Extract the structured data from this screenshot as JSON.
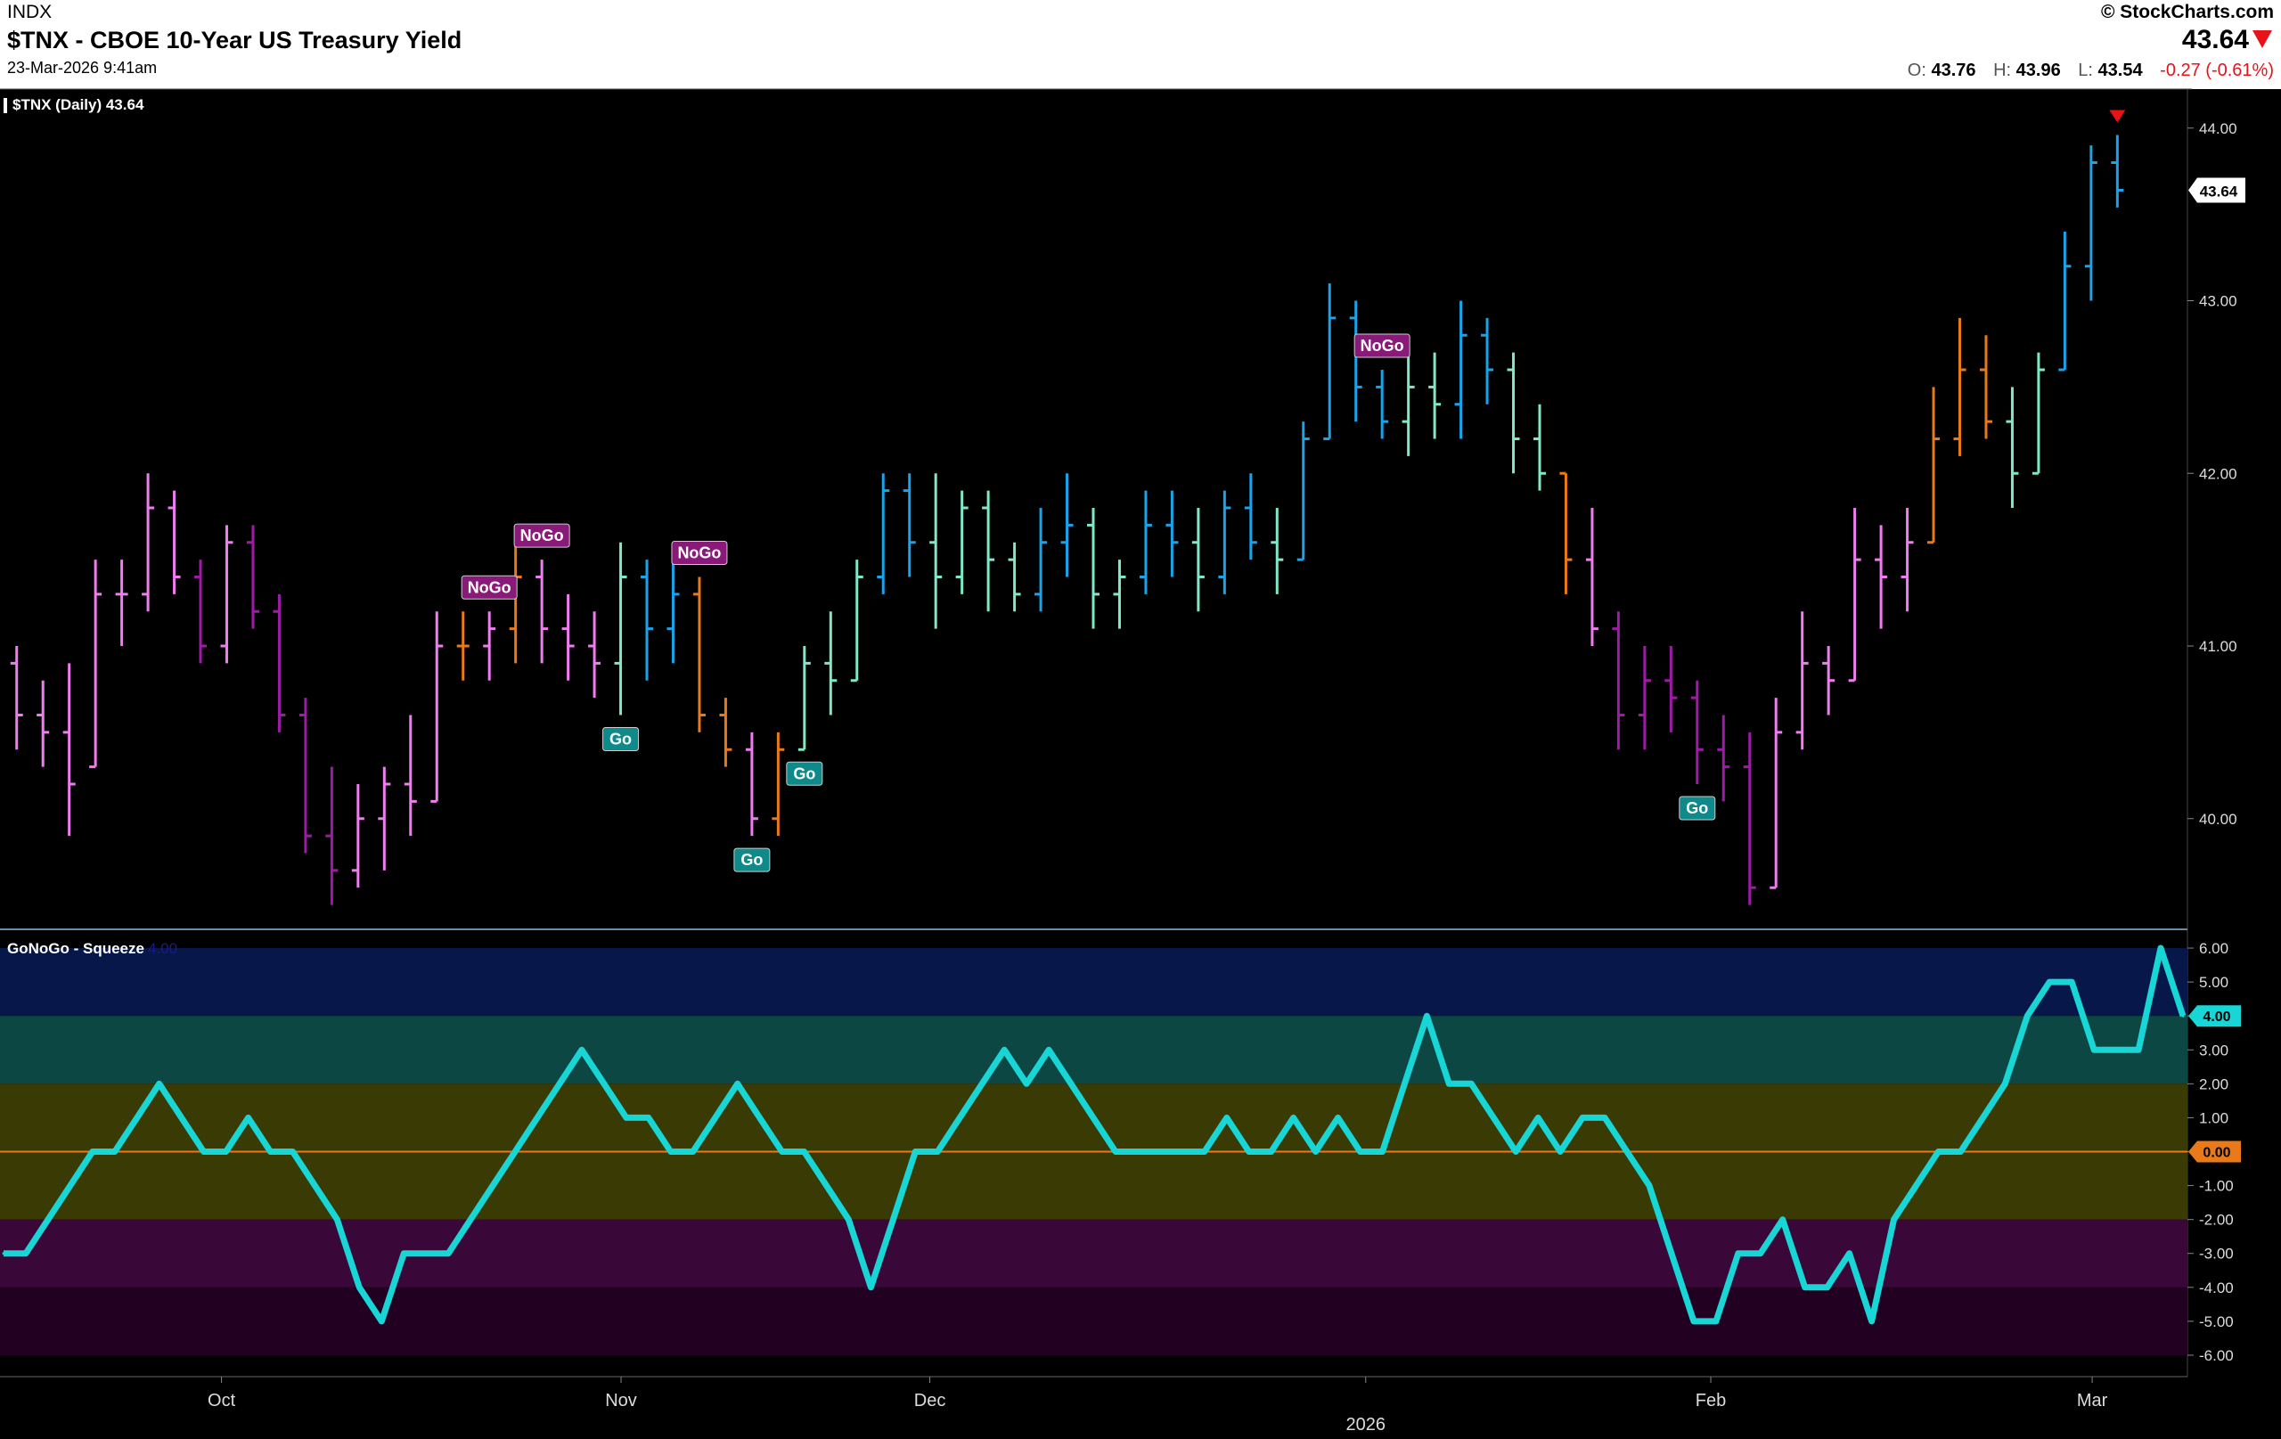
{
  "header": {
    "exchange": "INDX",
    "title": "$TNX - CBOE 10-Year US Treasury Yield",
    "date": "23-Mar-2026 9:41am",
    "brand": "© StockCharts.com",
    "last": "43.64",
    "open_label": "O:",
    "open": "43.76",
    "high_label": "H:",
    "high": "43.96",
    "low_label": "L:",
    "low": "43.54",
    "change": "-0.27 (-0.61%)"
  },
  "price_panel": {
    "label": "$TNX (Daily) 43.64",
    "last_tag": "43.64"
  },
  "sub_panel": {
    "label": "GoNoGo - Squeeze",
    "value_faint": "4.00",
    "oscillator_tag": "4.00",
    "zero_tag": "0.00"
  },
  "colors": {
    "up_strong": "#1aa3e8",
    "up_weak": "#7fe8c8",
    "down_strong": "#a01aa8",
    "down_weak": "#f07df0",
    "neutral": "#e87a1a",
    "oscillator": "#18d6d6",
    "zero_line": "#e87a1a",
    "go_badge": "#0f8a8a",
    "nogo_badge": "#8a1a7a",
    "dot": "#18e818",
    "down_signal": "#e8121a"
  },
  "chart_data": [
    {
      "type": "ohlc",
      "title": "$TNX (Daily) 43.64",
      "ylim": [
        39.4,
        44.2
      ],
      "y_ticks": [
        "44.00",
        "43.00",
        "42.00",
        "41.00",
        "40.00"
      ],
      "x_ticks": [
        "Oct",
        "Nov",
        "Dec",
        "2026",
        "Feb",
        "Mar"
      ],
      "annotations": [
        {
          "text": "NoGo",
          "index": 18
        },
        {
          "text": "NoGo",
          "index": 20
        },
        {
          "text": "Go",
          "index": 23
        },
        {
          "text": "NoGo",
          "index": 26
        },
        {
          "text": "Go",
          "index": 28
        },
        {
          "text": "Go",
          "index": 30
        },
        {
          "text": "NoGo",
          "index": 52
        },
        {
          "text": "Go",
          "index": 64
        }
      ],
      "bars": [
        {
          "o": 40.9,
          "h": 41.0,
          "l": 40.4,
          "c": 40.6,
          "k": "dw"
        },
        {
          "o": 40.6,
          "h": 40.8,
          "l": 40.3,
          "c": 40.5,
          "k": "dw"
        },
        {
          "o": 40.5,
          "h": 40.9,
          "l": 39.9,
          "c": 40.2,
          "k": "dw"
        },
        {
          "o": 40.3,
          "h": 41.5,
          "l": 40.3,
          "c": 41.3,
          "k": "dw"
        },
        {
          "o": 41.3,
          "h": 41.5,
          "l": 41.0,
          "c": 41.3,
          "k": "dw"
        },
        {
          "o": 41.3,
          "h": 42.0,
          "l": 41.2,
          "c": 41.8,
          "k": "dw"
        },
        {
          "o": 41.8,
          "h": 41.9,
          "l": 41.3,
          "c": 41.4,
          "k": "dw"
        },
        {
          "o": 41.4,
          "h": 41.5,
          "l": 40.9,
          "c": 41.0,
          "k": "ds"
        },
        {
          "o": 41.0,
          "h": 41.7,
          "l": 40.9,
          "c": 41.6,
          "k": "dw"
        },
        {
          "o": 41.6,
          "h": 41.7,
          "l": 41.1,
          "c": 41.2,
          "k": "ds"
        },
        {
          "o": 41.2,
          "h": 41.3,
          "l": 40.5,
          "c": 40.6,
          "k": "ds"
        },
        {
          "o": 40.6,
          "h": 40.7,
          "l": 39.8,
          "c": 39.9,
          "k": "ds"
        },
        {
          "o": 39.9,
          "h": 40.3,
          "l": 39.5,
          "c": 39.7,
          "k": "ds"
        },
        {
          "o": 39.7,
          "h": 40.2,
          "l": 39.6,
          "c": 40.0,
          "k": "dw"
        },
        {
          "o": 40.0,
          "h": 40.3,
          "l": 39.7,
          "c": 40.2,
          "k": "dw"
        },
        {
          "o": 40.2,
          "h": 40.6,
          "l": 39.9,
          "c": 40.1,
          "k": "dw"
        },
        {
          "o": 40.1,
          "h": 41.2,
          "l": 40.1,
          "c": 41.0,
          "k": "dw"
        },
        {
          "o": 41.0,
          "h": 41.2,
          "l": 40.8,
          "c": 41.0,
          "k": "n"
        },
        {
          "o": 41.0,
          "h": 41.2,
          "l": 40.8,
          "c": 41.1,
          "k": "dw"
        },
        {
          "o": 41.1,
          "h": 41.6,
          "l": 40.9,
          "c": 41.4,
          "k": "n"
        },
        {
          "o": 41.4,
          "h": 41.5,
          "l": 40.9,
          "c": 41.1,
          "k": "dw"
        },
        {
          "o": 41.1,
          "h": 41.3,
          "l": 40.8,
          "c": 41.0,
          "k": "dw"
        },
        {
          "o": 41.0,
          "h": 41.2,
          "l": 40.7,
          "c": 40.9,
          "k": "dw"
        },
        {
          "o": 40.9,
          "h": 41.6,
          "l": 40.6,
          "c": 41.4,
          "k": "uw"
        },
        {
          "o": 41.4,
          "h": 41.5,
          "l": 40.8,
          "c": 41.1,
          "k": "us"
        },
        {
          "o": 41.1,
          "h": 41.6,
          "l": 40.9,
          "c": 41.3,
          "k": "us"
        },
        {
          "o": 41.3,
          "h": 41.4,
          "l": 40.5,
          "c": 40.6,
          "k": "n"
        },
        {
          "o": 40.6,
          "h": 40.7,
          "l": 40.3,
          "c": 40.4,
          "k": "n"
        },
        {
          "o": 40.4,
          "h": 40.5,
          "l": 39.9,
          "c": 40.0,
          "k": "dw"
        },
        {
          "o": 40.0,
          "h": 40.5,
          "l": 39.9,
          "c": 40.4,
          "k": "n"
        },
        {
          "o": 40.4,
          "h": 41.0,
          "l": 40.4,
          "c": 40.9,
          "k": "uw"
        },
        {
          "o": 40.9,
          "h": 41.2,
          "l": 40.6,
          "c": 40.8,
          "k": "uw"
        },
        {
          "o": 40.8,
          "h": 41.5,
          "l": 40.8,
          "c": 41.4,
          "k": "uw"
        },
        {
          "o": 41.4,
          "h": 42.0,
          "l": 41.3,
          "c": 41.9,
          "k": "us"
        },
        {
          "o": 41.9,
          "h": 42.0,
          "l": 41.4,
          "c": 41.6,
          "k": "us"
        },
        {
          "o": 41.6,
          "h": 42.0,
          "l": 41.1,
          "c": 41.4,
          "k": "uw"
        },
        {
          "o": 41.4,
          "h": 41.9,
          "l": 41.3,
          "c": 41.8,
          "k": "uw"
        },
        {
          "o": 41.8,
          "h": 41.9,
          "l": 41.2,
          "c": 41.5,
          "k": "uw"
        },
        {
          "o": 41.5,
          "h": 41.6,
          "l": 41.2,
          "c": 41.3,
          "k": "uw"
        },
        {
          "o": 41.3,
          "h": 41.8,
          "l": 41.2,
          "c": 41.6,
          "k": "us"
        },
        {
          "o": 41.6,
          "h": 42.0,
          "l": 41.4,
          "c": 41.7,
          "k": "us"
        },
        {
          "o": 41.7,
          "h": 41.8,
          "l": 41.1,
          "c": 41.3,
          "k": "uw"
        },
        {
          "o": 41.3,
          "h": 41.5,
          "l": 41.1,
          "c": 41.4,
          "k": "uw"
        },
        {
          "o": 41.4,
          "h": 41.9,
          "l": 41.3,
          "c": 41.7,
          "k": "us"
        },
        {
          "o": 41.7,
          "h": 41.9,
          "l": 41.4,
          "c": 41.6,
          "k": "us"
        },
        {
          "o": 41.6,
          "h": 41.8,
          "l": 41.2,
          "c": 41.4,
          "k": "uw"
        },
        {
          "o": 41.4,
          "h": 41.9,
          "l": 41.3,
          "c": 41.8,
          "k": "us"
        },
        {
          "o": 41.8,
          "h": 42.0,
          "l": 41.5,
          "c": 41.6,
          "k": "us"
        },
        {
          "o": 41.6,
          "h": 41.8,
          "l": 41.3,
          "c": 41.5,
          "k": "uw"
        },
        {
          "o": 41.5,
          "h": 42.3,
          "l": 41.5,
          "c": 42.2,
          "k": "us"
        },
        {
          "o": 42.2,
          "h": 43.1,
          "l": 42.2,
          "c": 42.9,
          "k": "us"
        },
        {
          "o": 42.9,
          "h": 43.0,
          "l": 42.3,
          "c": 42.5,
          "k": "us"
        },
        {
          "o": 42.5,
          "h": 42.6,
          "l": 42.2,
          "c": 42.3,
          "k": "us"
        },
        {
          "o": 42.3,
          "h": 42.7,
          "l": 42.1,
          "c": 42.5,
          "k": "uw"
        },
        {
          "o": 42.5,
          "h": 42.7,
          "l": 42.2,
          "c": 42.4,
          "k": "uw"
        },
        {
          "o": 42.4,
          "h": 43.0,
          "l": 42.2,
          "c": 42.8,
          "k": "us"
        },
        {
          "o": 42.8,
          "h": 42.9,
          "l": 42.4,
          "c": 42.6,
          "k": "us"
        },
        {
          "o": 42.6,
          "h": 42.7,
          "l": 42.0,
          "c": 42.2,
          "k": "uw"
        },
        {
          "o": 42.2,
          "h": 42.4,
          "l": 41.9,
          "c": 42.0,
          "k": "uw"
        },
        {
          "o": 42.0,
          "h": 42.0,
          "l": 41.3,
          "c": 41.5,
          "k": "n"
        },
        {
          "o": 41.5,
          "h": 41.8,
          "l": 41.0,
          "c": 41.1,
          "k": "dw"
        },
        {
          "o": 41.1,
          "h": 41.2,
          "l": 40.4,
          "c": 40.6,
          "k": "ds"
        },
        {
          "o": 40.6,
          "h": 41.0,
          "l": 40.4,
          "c": 40.8,
          "k": "ds"
        },
        {
          "o": 40.8,
          "h": 41.0,
          "l": 40.5,
          "c": 40.7,
          "k": "ds"
        },
        {
          "o": 40.7,
          "h": 40.8,
          "l": 40.2,
          "c": 40.4,
          "k": "ds"
        },
        {
          "o": 40.4,
          "h": 40.6,
          "l": 40.1,
          "c": 40.3,
          "k": "ds"
        },
        {
          "o": 40.3,
          "h": 40.5,
          "l": 39.5,
          "c": 39.6,
          "k": "ds"
        },
        {
          "o": 39.6,
          "h": 40.7,
          "l": 39.6,
          "c": 40.5,
          "k": "dw"
        },
        {
          "o": 40.5,
          "h": 41.2,
          "l": 40.4,
          "c": 40.9,
          "k": "dw"
        },
        {
          "o": 40.9,
          "h": 41.0,
          "l": 40.6,
          "c": 40.8,
          "k": "dw"
        },
        {
          "o": 40.8,
          "h": 41.8,
          "l": 40.8,
          "c": 41.5,
          "k": "dw"
        },
        {
          "o": 41.5,
          "h": 41.7,
          "l": 41.1,
          "c": 41.4,
          "k": "dw"
        },
        {
          "o": 41.4,
          "h": 41.8,
          "l": 41.2,
          "c": 41.6,
          "k": "dw"
        },
        {
          "o": 41.6,
          "h": 42.5,
          "l": 41.6,
          "c": 42.2,
          "k": "n"
        },
        {
          "o": 42.2,
          "h": 42.9,
          "l": 42.1,
          "c": 42.6,
          "k": "n"
        },
        {
          "o": 42.6,
          "h": 42.8,
          "l": 42.2,
          "c": 42.3,
          "k": "n"
        },
        {
          "o": 42.3,
          "h": 42.5,
          "l": 41.8,
          "c": 42.0,
          "k": "uw"
        },
        {
          "o": 42.0,
          "h": 42.7,
          "l": 42.0,
          "c": 42.6,
          "k": "uw"
        },
        {
          "o": 42.6,
          "h": 43.4,
          "l": 42.6,
          "c": 43.2,
          "k": "us"
        },
        {
          "o": 43.2,
          "h": 43.9,
          "l": 43.0,
          "c": 43.8,
          "k": "us"
        },
        {
          "o": 43.8,
          "h": 43.96,
          "l": 43.54,
          "c": 43.64,
          "k": "us"
        }
      ]
    },
    {
      "type": "line",
      "title": "GoNoGo - Squeeze",
      "ylim": [
        -6.5,
        6.5
      ],
      "y_ticks": [
        "6.00",
        "5.00",
        "4.00",
        "3.00",
        "2.00",
        "1.00",
        "0.00",
        "-1.00",
        "-2.00",
        "-3.00",
        "-4.00",
        "-5.00",
        "-6.00"
      ],
      "series": [
        {
          "values": [
            -3,
            -3,
            -2,
            -1,
            0,
            0,
            1,
            2,
            1,
            0,
            0,
            1,
            0,
            0,
            -1,
            -2,
            -4,
            -5,
            -3,
            -3,
            -3,
            -2,
            -1,
            0,
            1,
            2,
            3,
            2,
            1,
            1,
            0,
            0,
            1,
            2,
            1,
            0,
            0,
            -1,
            -2,
            -4,
            -2,
            0,
            0,
            1,
            2,
            3,
            2,
            3,
            2,
            1,
            0,
            0,
            0,
            0,
            0,
            1,
            0,
            0,
            1,
            0,
            1,
            0,
            0,
            2,
            4,
            2,
            2,
            1,
            0,
            1,
            0,
            1,
            1,
            0,
            -1,
            -3,
            -5,
            -5,
            -3,
            -3,
            -2,
            -4,
            -4,
            -3,
            -5,
            -2,
            -1,
            0,
            0,
            1,
            2,
            4,
            5,
            5,
            3,
            3,
            3,
            6,
            4
          ]
        }
      ]
    }
  ]
}
